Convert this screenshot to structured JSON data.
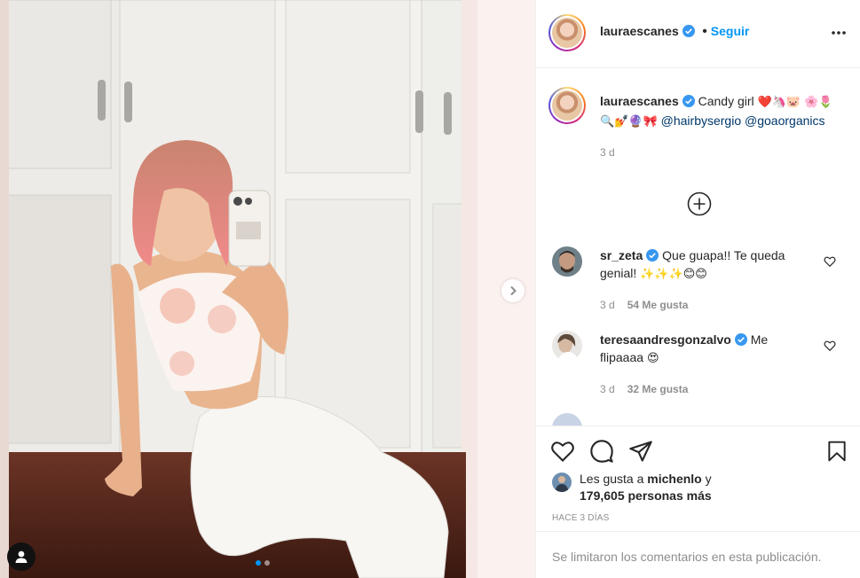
{
  "post": {
    "username": "lauraescanes",
    "follow_label": "Seguir",
    "caption_text": "Candy girl",
    "caption_emojis_1": "❤️🦄🐷",
    "caption_emojis_2": "🌸🌷🔍💅🔮🎀",
    "mention_1": "@hairbysergio",
    "mention_2": "@goaorganics",
    "caption_time": "3 d"
  },
  "comments": [
    {
      "username": "sr_zeta",
      "text": "Que guapa!! Te queda genial!",
      "emojis": "✨✨✨😊😊",
      "time": "3 d",
      "likes": "54 Me gusta"
    },
    {
      "username": "teresaandresgonzalvo",
      "text": "Me flipaaaa",
      "emojis": "😍",
      "time": "3 d",
      "likes": "32 Me gusta"
    }
  ],
  "likes": {
    "prefix": "Les gusta a",
    "user": "michenlo",
    "connector": "y",
    "others": "179,605 personas más"
  },
  "time_ago": "HACE 3 DÍAS",
  "comments_limited": "Se limitaron los comentarios en esta publicación.",
  "colors": {
    "accent": "#0095f6",
    "verified": "#3897f0",
    "text": "#262626",
    "muted": "#8e8e8e"
  },
  "icons": [
    "more-icon",
    "verified-icon",
    "plus-circle-icon",
    "heart-icon",
    "comment-icon",
    "share-icon",
    "save-icon",
    "user-tag-icon",
    "chevron-right-icon"
  ],
  "carousel": {
    "current": 1,
    "total": 2
  }
}
